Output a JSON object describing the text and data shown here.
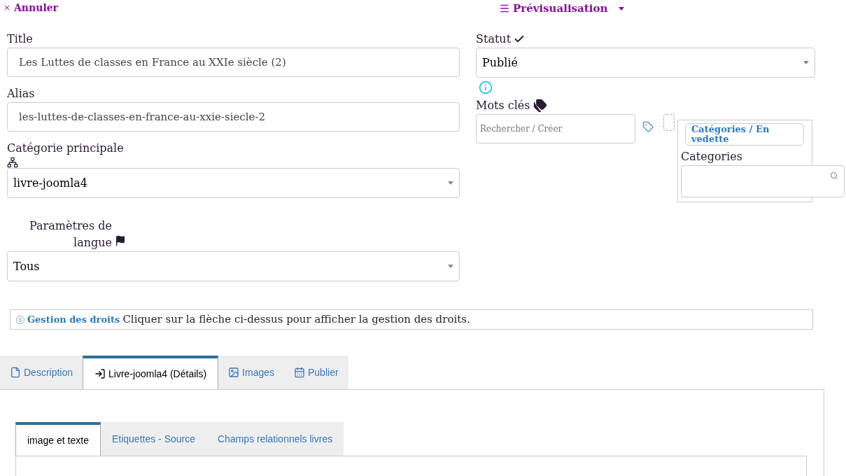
{
  "toolbar": {
    "cancel": "Annuler",
    "preview": "Prévisualisation"
  },
  "left_fields": [
    {
      "kind": "text",
      "label": "Title",
      "value": "Les Luttes de classes en France au XXIe siècle (2)"
    },
    {
      "kind": "text",
      "label": "Alias",
      "value": "les-luttes-de-classes-en-france-au-xxie-siecle-2"
    },
    {
      "kind": "select",
      "label": "Catégorie principale",
      "value": "livre-joomla4"
    },
    {
      "kind": "select",
      "label": "Paramètres de langue",
      "value": "Tous"
    }
  ],
  "status": {
    "label": "Statut",
    "value": "Publié"
  },
  "keywords": {
    "label": "Mots clés",
    "placeholder": "Rechercher / Créer"
  },
  "featured": {
    "button": "Catégories / En vedette",
    "label": "Categories"
  },
  "rights": {
    "link": "Gestion des droits",
    "text": "Cliquer sur la flèche ci-dessus pour afficher la gestion des droits."
  },
  "tabs": [
    {
      "label": "Description",
      "selected": false
    },
    {
      "label": "Livre-joomla4 (Détails)",
      "selected": true
    },
    {
      "label": "Images",
      "selected": false
    },
    {
      "label": "Publier",
      "selected": false
    }
  ],
  "subtabs": [
    {
      "label": "image et texte",
      "selected": true
    },
    {
      "label": "Etiquettes - Source",
      "selected": false
    },
    {
      "label": "Champs relationnels livres",
      "selected": false
    }
  ]
}
